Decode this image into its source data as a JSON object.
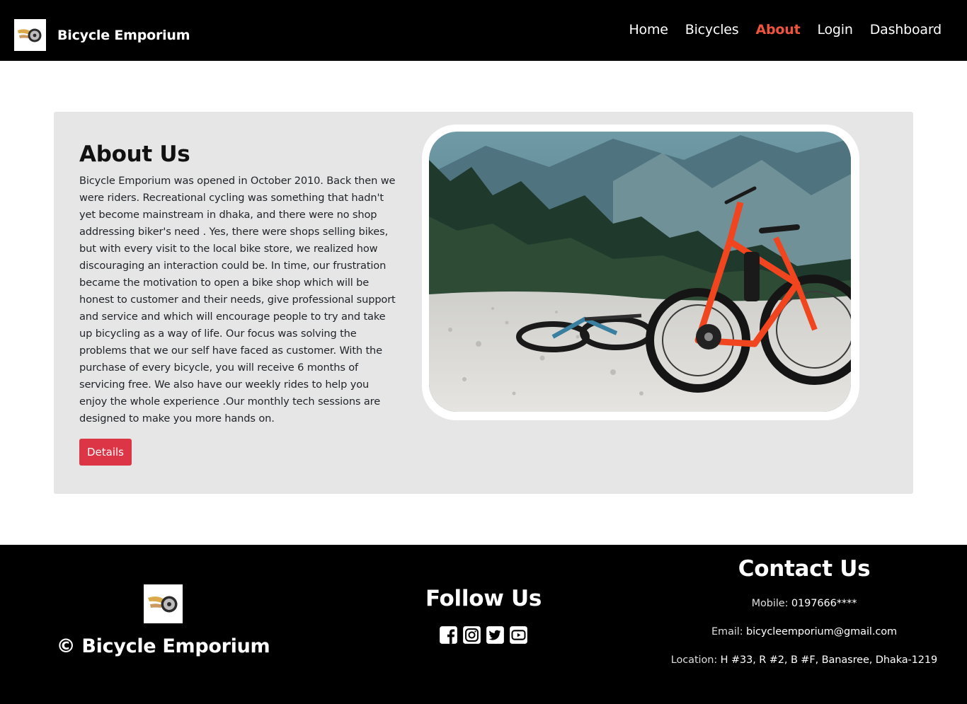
{
  "nav": {
    "brand": "Bicycle Emporium",
    "links": [
      {
        "label": "Home"
      },
      {
        "label": "Bicycles"
      },
      {
        "label": "About"
      },
      {
        "label": "Login"
      },
      {
        "label": "Dashboard"
      }
    ],
    "active_link": "About",
    "active_color": "#f0533e"
  },
  "about": {
    "title": "About Us",
    "body": "Bicycle Emporium was opened in October 2010. Back then we were riders. Recreational cycling was something that hadn't yet become mainstream in dhaka, and there were no shop addressing biker's need . Yes, there were shops selling bikes, but with every visit to the local bike store, we realized how discouraging an interaction could be. In time, our frustration became the motivation to open a bike shop which will be honest to customer and their needs, give professional support and service and which will encourage people to try and take up bicycling as a way of life. Our focus was solving the problems that we our self have faced as customer. With the purchase of every bicycle, you will receive 6 months of servicing free. We also have our weekly rides to help you enjoy the whole experience .Our monthly tech sessions are designed to make you more hands on.",
    "button_label": "Details",
    "button_color": "#dc3545"
  },
  "footer": {
    "copyright": "© Bicycle Emporium",
    "follow_title": "Follow Us",
    "social_icons": [
      "facebook-icon",
      "instagram-icon",
      "twitter-icon",
      "youtube-icon"
    ],
    "contact_title": "Contact Us",
    "mobile_label": "Mobile:",
    "mobile_value": "0197666****",
    "email_label": "Email:",
    "email_value": "bicycleemporium@gmail.com",
    "location_label": "Location:",
    "location_value": "H #33, R #2, B #F, Banasree, Dhaka-1219"
  }
}
